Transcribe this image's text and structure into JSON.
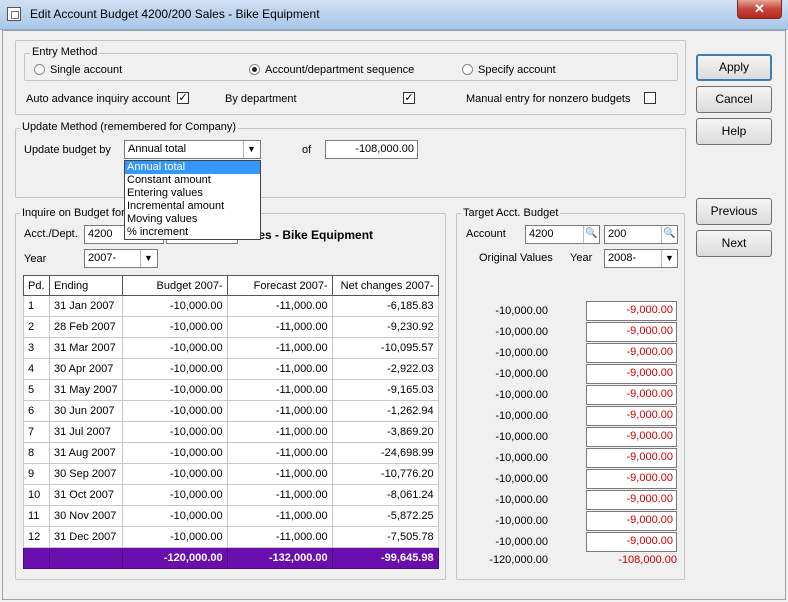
{
  "window": {
    "title": "Edit Account Budget 4200/200 Sales - Bike Equipment",
    "close_glyph": "✕"
  },
  "entry_method": {
    "label": "Entry Method",
    "single_account": "Single account",
    "account_department_sequence": "Account/department sequence",
    "specify_account": "Specify account",
    "selected": "account_department_sequence"
  },
  "options": {
    "auto_advance": "Auto advance inquiry account",
    "auto_advance_checked": true,
    "by_department": "By department",
    "by_department_checked": true,
    "manual_entry": "Manual entry for nonzero budgets",
    "manual_entry_checked": false
  },
  "update_method": {
    "label": "Update Method (remembered for Company)",
    "update_budget_by": "Update budget by",
    "selected": "Annual total",
    "of_label": "of",
    "of_value": "-108,000.00",
    "dropdown_options": [
      "Annual total",
      "Constant amount",
      "Entering values",
      "Incremental amount",
      "Moving values",
      "% increment"
    ]
  },
  "inquire": {
    "label": "Inquire on Budget for",
    "acct_dept_label": "Acct./Dept.",
    "account": "4200",
    "account_name": "les - Bike Equipment",
    "year_label": "Year",
    "year": "2007-",
    "columns": [
      "Pd.",
      "Ending",
      "Budget 2007-",
      "Forecast 2007-",
      "Net changes 2007-"
    ],
    "rows": [
      [
        "1",
        "31 Jan 2007",
        "-10,000.00",
        "-11,000.00",
        "-6,185.83"
      ],
      [
        "2",
        "28 Feb 2007",
        "-10,000.00",
        "-11,000.00",
        "-9,230.92"
      ],
      [
        "3",
        "31 Mar 2007",
        "-10,000.00",
        "-11,000.00",
        "-10,095.57"
      ],
      [
        "4",
        "30 Apr 2007",
        "-10,000.00",
        "-11,000.00",
        "-2,922.03"
      ],
      [
        "5",
        "31 May 2007",
        "-10,000.00",
        "-11,000.00",
        "-9,165.03"
      ],
      [
        "6",
        "30 Jun 2007",
        "-10,000.00",
        "-11,000.00",
        "-1,262.94"
      ],
      [
        "7",
        "31 Jul 2007",
        "-10,000.00",
        "-11,000.00",
        "-3,869.20"
      ],
      [
        "8",
        "31 Aug 2007",
        "-10,000.00",
        "-11,000.00",
        "-24,698.99"
      ],
      [
        "9",
        "30 Sep 2007",
        "-10,000.00",
        "-11,000.00",
        "-10,776.20"
      ],
      [
        "10",
        "31 Oct 2007",
        "-10,000.00",
        "-11,000.00",
        "-8,061.24"
      ],
      [
        "11",
        "30 Nov 2007",
        "-10,000.00",
        "-11,000.00",
        "-5,872.25"
      ],
      [
        "12",
        "31 Dec 2007",
        "-10,000.00",
        "-11,000.00",
        "-7,505.78"
      ]
    ],
    "totals": [
      "",
      "",
      "-120,000.00",
      "-132,000.00",
      "-99,645.98"
    ]
  },
  "target": {
    "label": "Target Acct. Budget",
    "account_label": "Account",
    "account": "4200",
    "department": "200",
    "original_values_label": "Original Values",
    "year_label": "Year",
    "year": "2008-",
    "original_values": [
      "-10,000.00",
      "-10,000.00",
      "-10,000.00",
      "-10,000.00",
      "-10,000.00",
      "-10,000.00",
      "-10,000.00",
      "-10,000.00",
      "-10,000.00",
      "-10,000.00",
      "-10,000.00",
      "-10,000.00"
    ],
    "new_values": [
      "-9,000.00",
      "-9,000.00",
      "-9,000.00",
      "-9,000.00",
      "-9,000.00",
      "-9,000.00",
      "-9,000.00",
      "-9,000.00",
      "-9,000.00",
      "-9,000.00",
      "-9,000.00",
      "-9,000.00"
    ],
    "original_total": "-120,000.00",
    "new_total": "-108,000.00"
  },
  "buttons": {
    "apply": "Apply",
    "cancel": "Cancel",
    "help": "Help",
    "previous": "Previous",
    "next": "Next"
  },
  "colors": {
    "total_row_bg": "#6a0dad",
    "target_value_text": "#d00000",
    "list_highlight": "#3399ff"
  }
}
